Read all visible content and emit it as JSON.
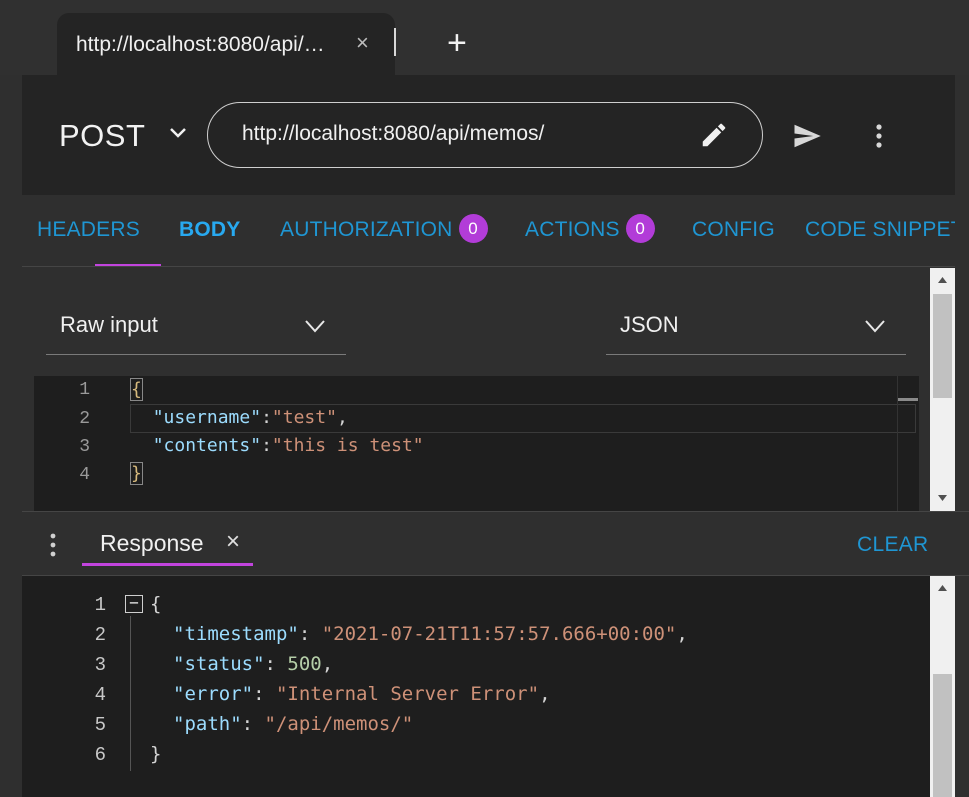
{
  "browser_tab": {
    "title": "http://localhost:8080/api/…",
    "close_glyph": "×",
    "new_tab_glyph": "+"
  },
  "request": {
    "method": "POST",
    "url": "http://localhost:8080/api/memos/"
  },
  "tabs": [
    {
      "label": "HEADERS",
      "badge": null,
      "active": false
    },
    {
      "label": "BODY",
      "badge": null,
      "active": true
    },
    {
      "label": "AUTHORIZATION",
      "badge": "0",
      "active": false
    },
    {
      "label": "ACTIONS",
      "badge": "0",
      "active": false
    },
    {
      "label": "CONFIG",
      "badge": null,
      "active": false
    },
    {
      "label": "CODE SNIPPET",
      "badge": null,
      "active": false
    }
  ],
  "body": {
    "input_type": "Raw input",
    "content_type": "JSON",
    "line_numbers": [
      "1",
      "2",
      "3",
      "4"
    ],
    "lines": {
      "l1_open": "{",
      "l2_key": "\"username\"",
      "l2_colon": ":",
      "l2_val": "\"test\"",
      "l2_comma": ",",
      "l3_key": "\"contents\"",
      "l3_colon": ":",
      "l3_val": "\"this is test\"",
      "l4_close": "}"
    }
  },
  "response": {
    "tab_label": "Response",
    "close_glyph": "×",
    "clear_label": "CLEAR",
    "fold_glyph": "−",
    "line_numbers": [
      "1",
      "2",
      "3",
      "4",
      "5",
      "6"
    ],
    "open_brace": "{",
    "close_brace": "}",
    "fields": [
      {
        "key": "\"timestamp\"",
        "value": "\"2021-07-21T11:57:57.666+00:00\"",
        "kind": "string",
        "comma": ","
      },
      {
        "key": "\"status\"",
        "value": "500",
        "kind": "number",
        "comma": ","
      },
      {
        "key": "\"error\"",
        "value": "\"Internal Server Error\"",
        "kind": "string",
        "comma": ","
      },
      {
        "key": "\"path\"",
        "value": "\"/api/memos/\"",
        "kind": "string",
        "comma": ""
      }
    ]
  },
  "colors": {
    "accent_purple": "#c244de",
    "badge_purple": "#b23cd8",
    "link_blue": "#1f96d3",
    "json_key": "#9cdcfe",
    "json_string": "#ce9178",
    "json_number": "#b5cea8"
  }
}
